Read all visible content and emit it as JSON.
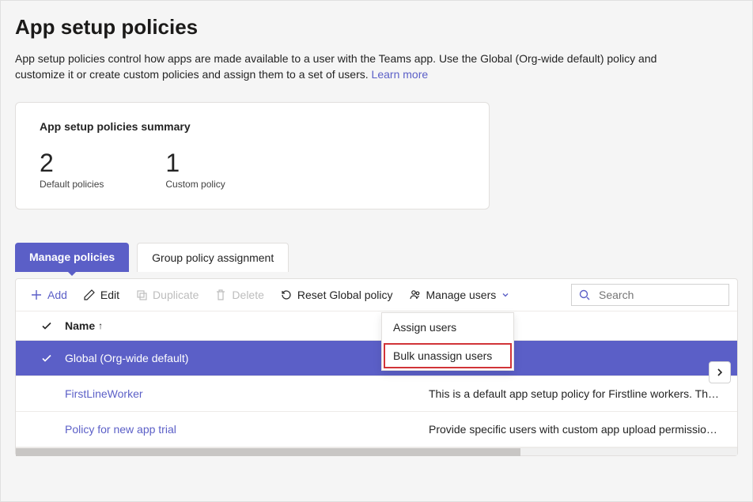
{
  "header": {
    "title": "App setup policies",
    "description_pre": "App setup policies control how apps are made available to a user with the Teams app. Use the Global (Org-wide default) policy and customize it or create custom policies and assign them to a set of users. ",
    "learn_more": "Learn more"
  },
  "summary": {
    "card_title": "App setup policies summary",
    "stats": [
      {
        "value": "2",
        "label": "Default policies"
      },
      {
        "value": "1",
        "label": "Custom policy"
      }
    ]
  },
  "tabs": {
    "manage": "Manage policies",
    "group": "Group policy assignment"
  },
  "toolbar": {
    "add": "Add",
    "edit": "Edit",
    "duplicate": "Duplicate",
    "delete": "Delete",
    "reset": "Reset Global policy",
    "manage_users": "Manage users",
    "search_placeholder": "Search"
  },
  "manage_users_menu": {
    "assign": "Assign users",
    "bulk_unassign": "Bulk unassign users"
  },
  "table": {
    "header_name": "Name",
    "rows": [
      {
        "name": "Global (Org-wide default)",
        "desc": "",
        "selected": true
      },
      {
        "name": "FirstLineWorker",
        "desc": "This is a default app setup policy for Firstline workers. Th…",
        "selected": false
      },
      {
        "name": "Policy for new app trial",
        "desc": "Provide specific users with custom app upload permissio…",
        "selected": false
      }
    ]
  }
}
